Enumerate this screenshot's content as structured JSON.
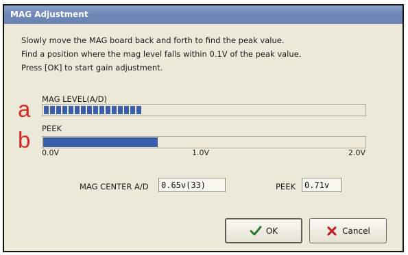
{
  "window": {
    "title": "MAG Adjustment"
  },
  "instructions": [
    "Slowly move the MAG board back and forth to find the peak value.",
    "Find a position where the mag level falls within 0.1V of the peak value.",
    "Press [OK] to start gain adjustment."
  ],
  "annotations": {
    "a": "a",
    "b": "b"
  },
  "mag_level": {
    "label": "MAG LEVEL(A/D)",
    "fraction": 0.33,
    "segments": 16
  },
  "peek": {
    "label": "PEEK",
    "fraction": 0.355
  },
  "scale": {
    "min": "0.0V",
    "mid": "1.0V",
    "max": "2.0V"
  },
  "center": {
    "label": "MAG CENTER A/D",
    "value": "0.65v(33)"
  },
  "peek_value": {
    "label": "PEEK",
    "value": "0.71v"
  },
  "buttons": {
    "ok": "OK",
    "cancel": "Cancel"
  },
  "colors": {
    "accent": "#3a5eaa",
    "title_bar": "#7089b8",
    "marker": "#d62626"
  },
  "icons": {
    "ok": "checkmark-icon",
    "cancel": "x-icon"
  }
}
